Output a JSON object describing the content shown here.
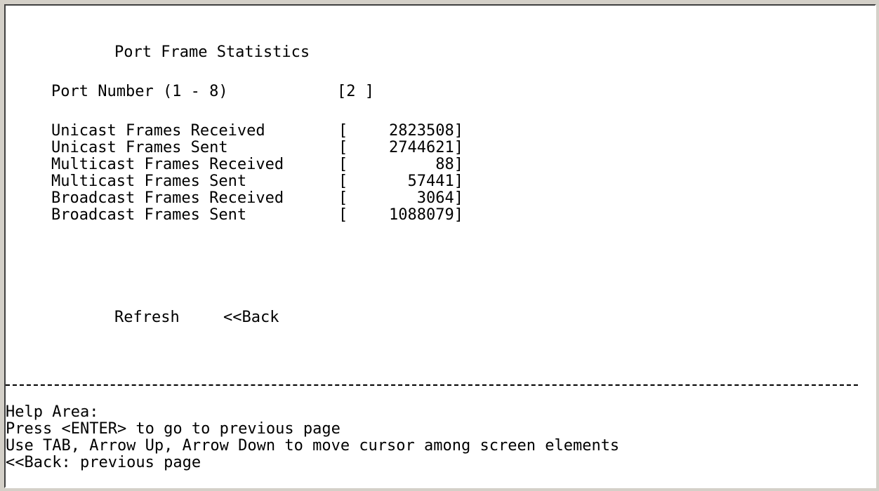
{
  "title": "Port Frame Statistics",
  "port": {
    "label": "Port Number (1 - 8)",
    "value": "[2 ]"
  },
  "stats": [
    {
      "label": "Unicast Frames Received",
      "value": "2823508"
    },
    {
      "label": "Unicast Frames Sent",
      "value": "2744621"
    },
    {
      "label": "Multicast Frames Received",
      "value": "88"
    },
    {
      "label": "Multicast Frames Sent",
      "value": "57441"
    },
    {
      "label": "Broadcast Frames Received",
      "value": "3064"
    },
    {
      "label": "Broadcast Frames Sent",
      "value": "1088079"
    }
  ],
  "buttons": {
    "refresh": "Refresh",
    "back": "<<Back"
  },
  "help": {
    "heading": "Help Area:",
    "lines": [
      "Press <ENTER> to go to previous page",
      "Use TAB, Arrow Up, Arrow Down to move cursor among screen elements",
      "<<Back: previous page"
    ]
  }
}
